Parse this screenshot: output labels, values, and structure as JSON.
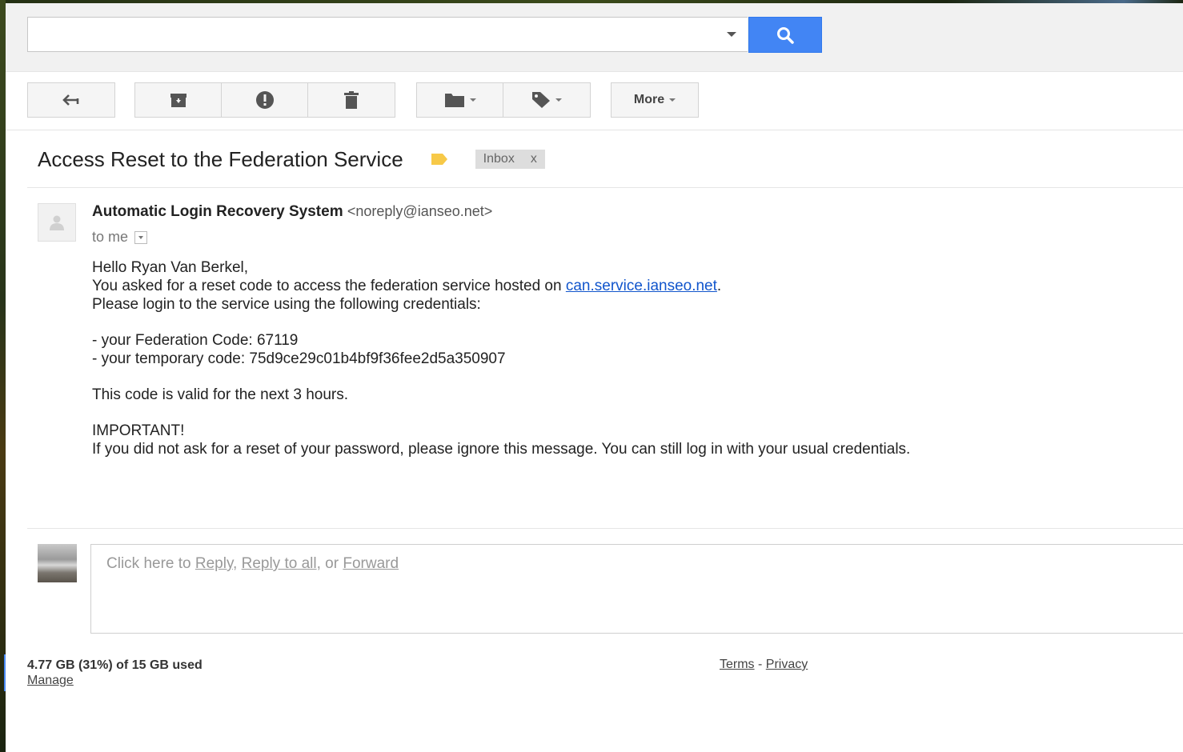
{
  "search": {
    "value": "",
    "placeholder": ""
  },
  "toolbar": {
    "more_label": "More"
  },
  "email": {
    "subject": "Access Reset to the Federation Service",
    "label_chip": "Inbox",
    "label_chip_close": "x",
    "sender_name": "Automatic Login Recovery System",
    "sender_email": "<noreply@ianseo.net>",
    "to_label": "to me",
    "body": {
      "greeting": "Hello Ryan Van Berkel,",
      "line1_prefix": "You asked for a reset code to access the federation service hosted on ",
      "line1_link": "can.service.ianseo.net",
      "line1_suffix": ".",
      "line2": "Please login to the service using the following credentials:",
      "federation_code": "- your Federation Code: 67119",
      "temporary_code": "- your temporary code: 75d9ce29c01b4bf9f36fee2d5a350907",
      "validity": "This code is valid for the next 3 hours.",
      "important_heading": "IMPORTANT!",
      "important_text": "If you did not ask for a reset of your password, please ignore this message. You can still log in with your usual credentials."
    }
  },
  "reply": {
    "prefix": "Click here to ",
    "reply_link": "Reply",
    "sep1": ", ",
    "reply_all_link": "Reply to all",
    "sep2": ", or ",
    "forward_link": "Forward"
  },
  "footer": {
    "storage_used": "4.77 GB (31%) of 15 GB used",
    "manage_link": "Manage",
    "terms_link": "Terms",
    "separator": " - ",
    "privacy_link": "Privacy"
  },
  "colors": {
    "search_button": "#4285f4",
    "label_tag": "#f7c948",
    "link": "#1155cc"
  }
}
